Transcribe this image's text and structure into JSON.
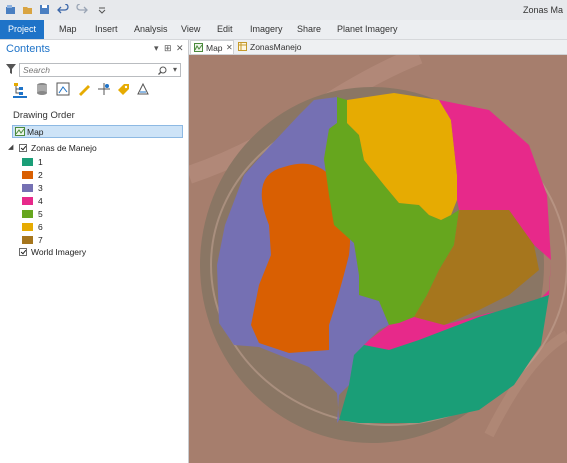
{
  "app": {
    "title": "Zonas Ma"
  },
  "ribbon": {
    "tabs": [
      "Project",
      "Map",
      "Insert",
      "Analysis",
      "View",
      "Edit",
      "Imagery",
      "Share",
      "Planet Imagery"
    ]
  },
  "contents": {
    "title": "Contents",
    "search_placeholder": "Search",
    "drawing_order_label": "Drawing Order",
    "map_label": "Map",
    "layer_label": "Zonas de Manejo",
    "classes": [
      {
        "label": "1",
        "color": "#1a9e77"
      },
      {
        "label": "2",
        "color": "#d95f02"
      },
      {
        "label": "3",
        "color": "#7570b3"
      },
      {
        "label": "4",
        "color": "#e7298a"
      },
      {
        "label": "5",
        "color": "#66a61e"
      },
      {
        "label": "6",
        "color": "#e6ab02"
      },
      {
        "label": "7",
        "color": "#a6761d"
      }
    ],
    "basemap_label": "World Imagery"
  },
  "view_tabs": [
    "Map",
    "ZonasManejo"
  ]
}
